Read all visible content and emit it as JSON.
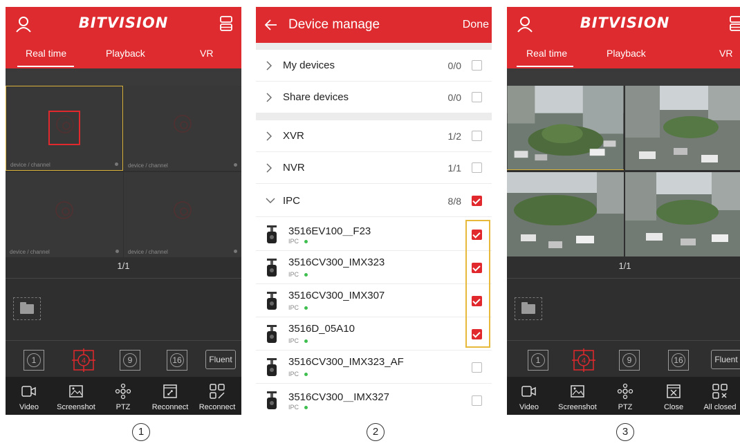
{
  "app": {
    "brand": "BITVISION",
    "tabs": [
      "Real time",
      "Playback",
      "VR"
    ]
  },
  "live_view": {
    "cell_label": "device / channel",
    "page_indicator": "1/1",
    "layouts": [
      "1",
      "4",
      "9",
      "16"
    ],
    "stream_mode": "Fluent"
  },
  "toolbar_panel1": [
    "Video",
    "Screenshot",
    "PTZ",
    "Reconnect",
    "Reconnect"
  ],
  "toolbar_panel3": [
    "Video",
    "Screenshot",
    "PTZ",
    "Close",
    "All closed"
  ],
  "device_manage": {
    "title": "Device manage",
    "done": "Done",
    "groups": [
      {
        "name": "My devices",
        "count": "0/0",
        "checked": false
      },
      {
        "name": "Share devices",
        "count": "0/0",
        "checked": false
      },
      {
        "name": "XVR",
        "count": "1/2",
        "checked": false
      },
      {
        "name": "NVR",
        "count": "1/1",
        "checked": false
      },
      {
        "name": "IPC",
        "count": "8/8",
        "checked": true
      }
    ],
    "devices": [
      {
        "name": "3516EV100＿F23",
        "type": "IPC",
        "checked": true
      },
      {
        "name": "3516CV300_IMX323",
        "type": "IPC",
        "checked": true
      },
      {
        "name": "3516CV300_IMX307",
        "type": "IPC",
        "checked": true
      },
      {
        "name": "3516D_05A10",
        "type": "IPC",
        "checked": true
      },
      {
        "name": "3516CV300_IMX323_AF",
        "type": "IPC",
        "checked": false
      },
      {
        "name": "3516CV300＿IMX327",
        "type": "IPC",
        "checked": false
      }
    ]
  },
  "captions": [
    "1",
    "2",
    "3"
  ],
  "colors": {
    "brand_red": "#dd2b2f",
    "highlight_yellow": "#e6b93a",
    "online_green": "#3fbf4f"
  }
}
